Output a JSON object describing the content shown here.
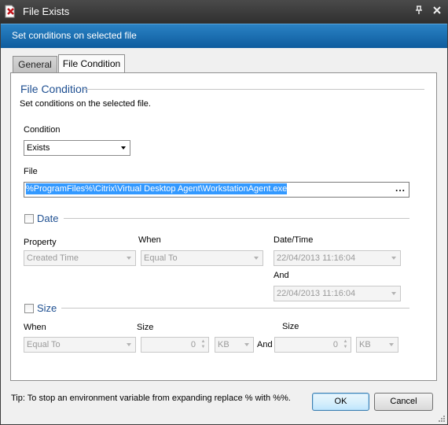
{
  "window": {
    "title": "File Exists",
    "icons": {
      "app": "file-exists-app-icon",
      "pin": "pin-icon",
      "close": "close-icon"
    }
  },
  "banner": {
    "text": "Set conditions on selected file"
  },
  "tabs": [
    {
      "label": "General",
      "selected": false
    },
    {
      "label": "File Condition",
      "selected": true
    }
  ],
  "file_condition": {
    "group_title": "File Condition",
    "description": "Set conditions on the selected file.",
    "condition": {
      "label": "Condition",
      "value": "Exists"
    },
    "file": {
      "label": "File",
      "value": "%ProgramFiles%\\Citrix\\Virtual Desktop Agent\\WorkstationAgent.exe",
      "browse_label": "..."
    }
  },
  "date_section": {
    "checkbox_label": "Date",
    "checked": false,
    "property": {
      "label": "Property",
      "value": "Created Time"
    },
    "when": {
      "label": "When",
      "value": "Equal To"
    },
    "datetime": {
      "label": "Date/Time",
      "value": "22/04/2013 11:16:04"
    },
    "and_datetime": {
      "label": "And",
      "value": "22/04/2013 11:16:04"
    }
  },
  "size_section": {
    "checkbox_label": "Size",
    "checked": false,
    "when": {
      "label": "When",
      "value": "Equal To"
    },
    "size1": {
      "label": "Size",
      "value": "0",
      "unit": "KB"
    },
    "and_label": "And",
    "size2": {
      "label": "Size",
      "value": "0",
      "unit": "KB"
    }
  },
  "footer": {
    "tip": "Tip: To stop an environment variable from expanding replace % with %%.",
    "ok_label": "OK",
    "cancel_label": "Cancel"
  },
  "colors": {
    "title_bar": "#3a3a3a",
    "banner": "#1a6fb2",
    "section_title": "#1e4f91",
    "selection": "#3399ff"
  }
}
